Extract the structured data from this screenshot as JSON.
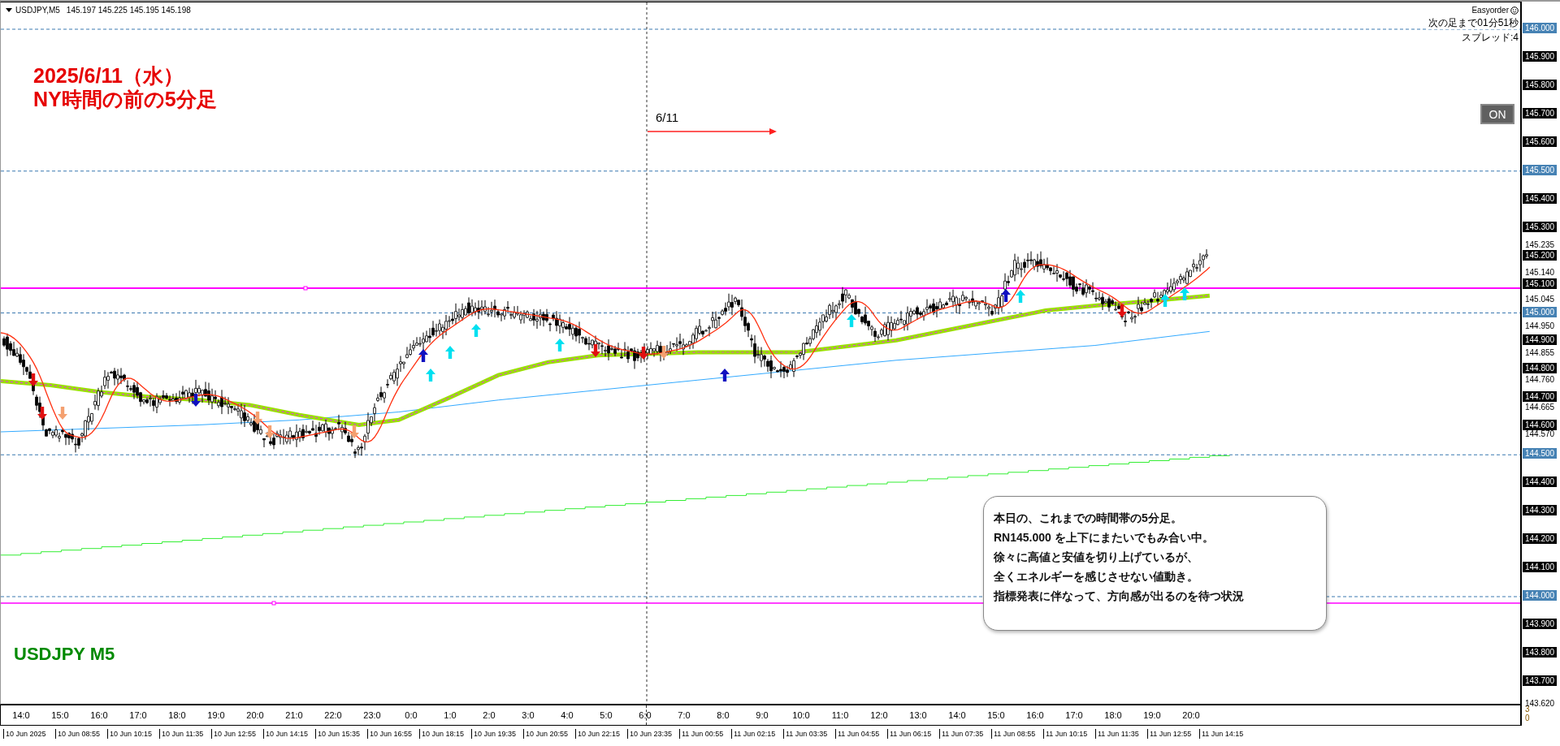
{
  "header": {
    "symbol": "USDJPY,M5",
    "quote": "145.197 145.225 145.195 145.198"
  },
  "title_lines": [
    "2025/6/11（水）",
    "NY時間の前の5分足"
  ],
  "date_marker": "6/11",
  "symbol_label": "USDJPY M5",
  "panel": {
    "brand": "Easyorder",
    "countdown": "次の足まで01分51秒",
    "spread": "スプレッド:4",
    "toggle_label": "ON"
  },
  "note_lines": [
    "本日の、これまでの時間帯の5分足。",
    "RN145.000 を上下にまたいでもみ合い中。",
    "徐々に高値と安値を切り上げているが、",
    "全くエネルギーを感じさせない値動き。",
    "指標発表に伴なって、方向感が出るのを待つ状況"
  ],
  "price_axis": [
    {
      "price": "146.000",
      "kind": "level"
    },
    {
      "price": "145.900",
      "kind": "major"
    },
    {
      "price": "145.800",
      "kind": "major"
    },
    {
      "price": "145.700",
      "kind": "major"
    },
    {
      "price": "145.600",
      "kind": "major"
    },
    {
      "price": "145.500",
      "kind": "level"
    },
    {
      "price": "145.400",
      "kind": "major"
    },
    {
      "price": "145.300",
      "kind": "major"
    },
    {
      "price": "145.235",
      "kind": "minor"
    },
    {
      "price": "145.200",
      "kind": "major"
    },
    {
      "price": "145.140",
      "kind": "minor"
    },
    {
      "price": "145.100",
      "kind": "major"
    },
    {
      "price": "145.045",
      "kind": "minor"
    },
    {
      "price": "145.000",
      "kind": "level"
    },
    {
      "price": "144.950",
      "kind": "minor"
    },
    {
      "price": "144.900",
      "kind": "major"
    },
    {
      "price": "144.855",
      "kind": "minor"
    },
    {
      "price": "144.800",
      "kind": "major"
    },
    {
      "price": "144.760",
      "kind": "minor"
    },
    {
      "price": "144.700",
      "kind": "major"
    },
    {
      "price": "144.665",
      "kind": "minor"
    },
    {
      "price": "144.600",
      "kind": "major"
    },
    {
      "price": "144.570",
      "kind": "minor"
    },
    {
      "price": "144.500",
      "kind": "level"
    },
    {
      "price": "144.400",
      "kind": "major"
    },
    {
      "price": "144.300",
      "kind": "major"
    },
    {
      "price": "144.200",
      "kind": "major"
    },
    {
      "price": "144.100",
      "kind": "major"
    },
    {
      "price": "144.000",
      "kind": "level"
    },
    {
      "price": "143.900",
      "kind": "major"
    },
    {
      "price": "143.800",
      "kind": "major"
    },
    {
      "price": "143.700",
      "kind": "major"
    },
    {
      "price": "143.620",
      "kind": "minor"
    }
  ],
  "sub_axis": [
    "3",
    "0"
  ],
  "hour_labels": [
    "14:0",
    "15:0",
    "16:0",
    "17:0",
    "18:0",
    "19:0",
    "20:0",
    "21:0",
    "22:0",
    "23:0",
    "0:0",
    "1:0",
    "2:0",
    "3:0",
    "4:0",
    "5:0",
    "6:0",
    "7:0",
    "8:0",
    "9:0",
    "10:0",
    "11:0",
    "12:0",
    "13:0",
    "14:0",
    "15:0",
    "16:0",
    "17:0",
    "18:0",
    "19:0",
    "20:0"
  ],
  "time_labels": [
    "10 Jun 2025",
    "10 Jun 08:55",
    "10 Jun 10:15",
    "10 Jun 11:35",
    "10 Jun 12:55",
    "10 Jun 14:15",
    "10 Jun 15:35",
    "10 Jun 16:55",
    "10 Jun 18:15",
    "10 Jun 19:35",
    "10 Jun 20:55",
    "10 Jun 22:15",
    "10 Jun 23:35",
    "11 Jun 00:55",
    "11 Jun 02:15",
    "11 Jun 03:35",
    "11 Jun 04:55",
    "11 Jun 06:15",
    "11 Jun 07:35",
    "11 Jun 08:55",
    "11 Jun 10:15",
    "11 Jun 11:35",
    "11 Jun 12:55",
    "11 Jun 14:15"
  ]
}
